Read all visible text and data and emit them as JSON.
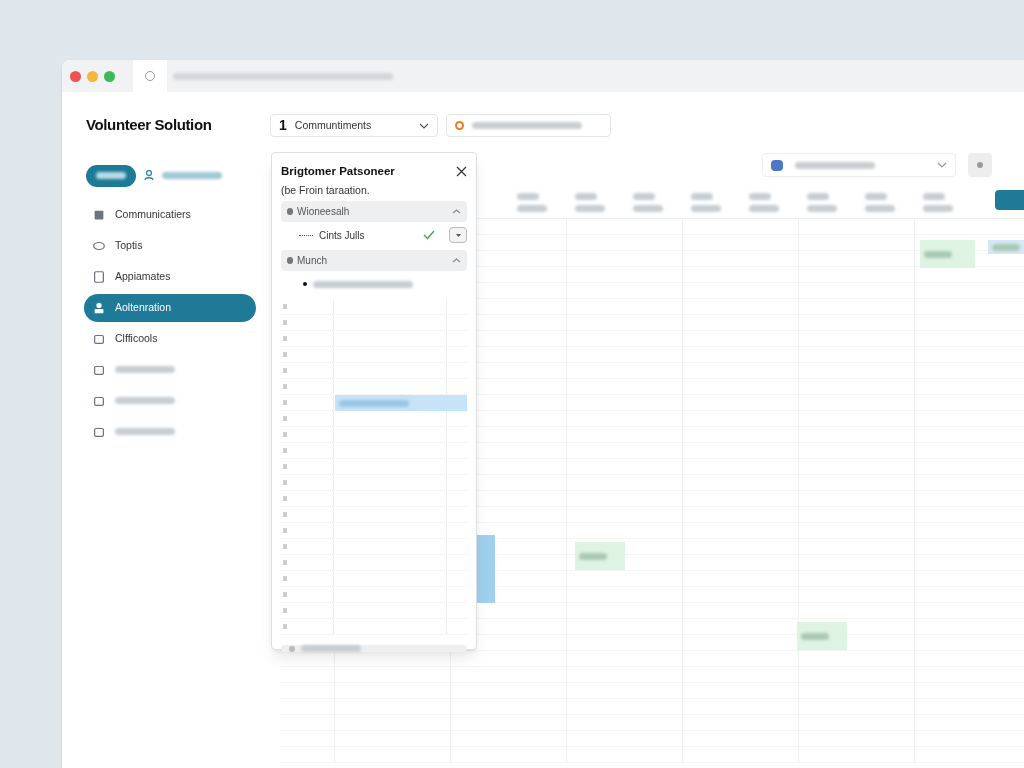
{
  "app": {
    "title": "Volunteer Solution"
  },
  "sidebar": {
    "items": [
      {
        "kind": "text",
        "label": "Communicatiers",
        "selected": false
      },
      {
        "kind": "text",
        "label": "Toptis",
        "selected": false
      },
      {
        "kind": "text",
        "label": "Appiamates",
        "selected": false
      },
      {
        "kind": "text",
        "label": "Aoltenration",
        "selected": true
      },
      {
        "kind": "text",
        "label": "Clfficools",
        "selected": false
      },
      {
        "kind": "blurred",
        "selected": false
      },
      {
        "kind": "blurred",
        "selected": false
      },
      {
        "kind": "blurred",
        "selected": false
      }
    ]
  },
  "toolbar": {
    "count": "1",
    "dropdown": "Communtiments"
  },
  "calendar": {
    "events": [
      {
        "color": "#dff3e3"
      },
      {
        "color": "#dff3e3"
      },
      {
        "color": "#dff3e3"
      },
      {
        "color": "#9fd0ee"
      },
      {
        "color": "#d6e8f5"
      }
    ]
  },
  "popup": {
    "title": "Brigtomer Patsoneer",
    "subtitle": "(be Froin taraation.",
    "sections": [
      {
        "label": "Wioneesalh",
        "expanded": true,
        "children": [
          {
            "kind": "text",
            "label": "Cints Julls",
            "checked": true
          }
        ]
      },
      {
        "label": "Munch",
        "expanded": true,
        "children": [
          {
            "kind": "blurred"
          }
        ]
      }
    ]
  }
}
